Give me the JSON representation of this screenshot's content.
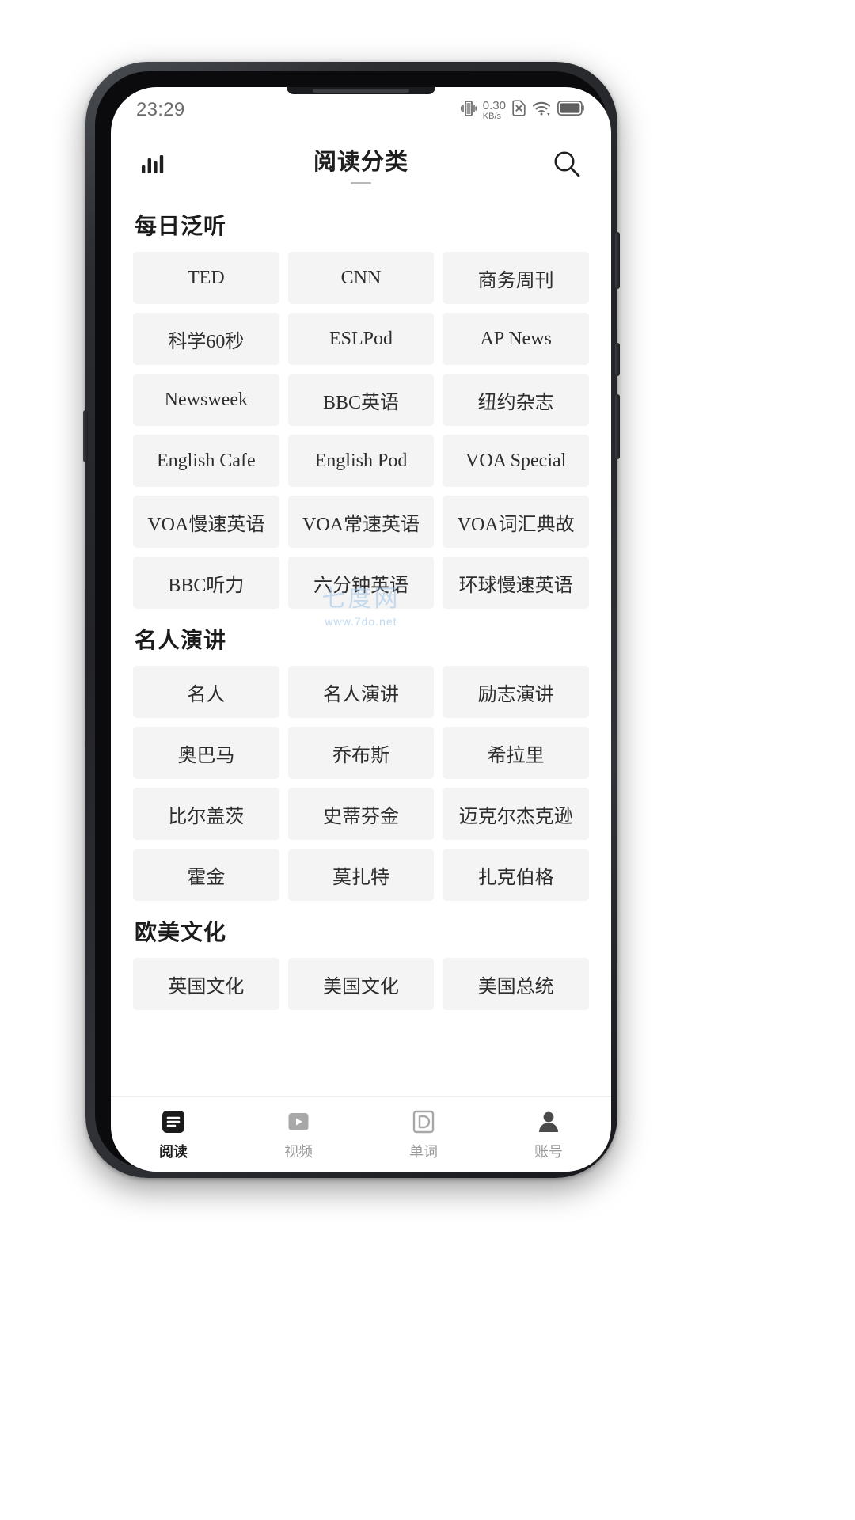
{
  "status_bar": {
    "time": "23:29",
    "net_speed_value": "0.30",
    "net_speed_unit": "KB/s",
    "icons": [
      "vibrate-icon",
      "no-sim-icon",
      "wifi-icon",
      "battery-icon"
    ]
  },
  "app_bar": {
    "title": "阅读分类",
    "left_icon": "bar-chart-icon",
    "right_icon": "search-icon"
  },
  "watermark": {
    "big": "七度网",
    "small": "www.7do.net",
    "color": "#9fc3e8"
  },
  "sections": [
    {
      "title": "每日泛听",
      "items": [
        "TED",
        "CNN",
        "商务周刊",
        "科学60秒",
        "ESLPod",
        "AP News",
        "Newsweek",
        "BBC英语",
        "纽约杂志",
        "English Cafe",
        "English Pod",
        "VOA Special",
        "VOA慢速英语",
        "VOA常速英语",
        "VOA词汇典故",
        "BBC听力",
        "六分钟英语",
        "环球慢速英语"
      ]
    },
    {
      "title": "名人演讲",
      "items": [
        "名人",
        "名人演讲",
        "励志演讲",
        "奥巴马",
        "乔布斯",
        "希拉里",
        "比尔盖茨",
        "史蒂芬金",
        "迈克尔杰克逊",
        "霍金",
        "莫扎特",
        "扎克伯格"
      ]
    },
    {
      "title": "欧美文化",
      "items": [
        "英国文化",
        "美国文化",
        "美国总统"
      ]
    }
  ],
  "tab_bar": {
    "items": [
      {
        "label": "阅读",
        "icon": "reading-list-icon",
        "active": true
      },
      {
        "label": "视频",
        "icon": "video-play-icon",
        "active": false
      },
      {
        "label": "单词",
        "icon": "dictionary-icon",
        "active": false
      },
      {
        "label": "账号",
        "icon": "person-icon",
        "active": false
      }
    ]
  },
  "theme": {
    "chip_bg": "#f4f4f4",
    "text_primary": "#1b1b1b",
    "text_muted": "#9a9a9a"
  }
}
